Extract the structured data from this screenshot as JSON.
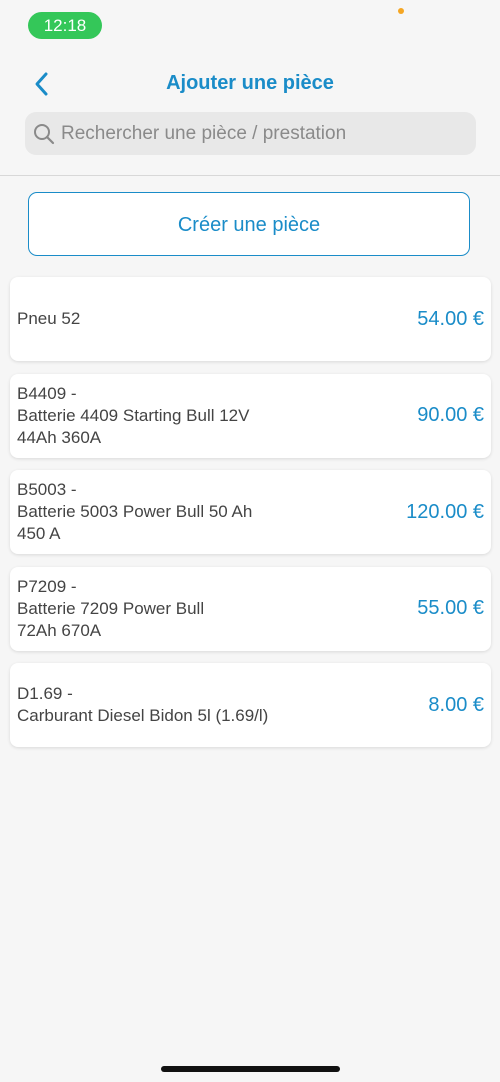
{
  "status_bar": {
    "time": "12:18"
  },
  "header": {
    "title": "Ajouter une pièce",
    "back_icon": "chevron-left-icon"
  },
  "search": {
    "placeholder": "Rechercher une pièce / prestation",
    "value": "",
    "icon": "search-icon"
  },
  "create_button": {
    "label": "Créer une pièce"
  },
  "parts": [
    {
      "name": "Pneu 52",
      "price": "54.00 €"
    },
    {
      "name": "B4409 -\nBatterie 4409 Starting Bull 12V\n44Ah 360A",
      "price": "90.00 €"
    },
    {
      "name": "B5003 -\nBatterie 5003 Power Bull 50 Ah\n450 A",
      "price": "120.00 €"
    },
    {
      "name": "P7209  -\nBatterie 7209 Power Bull\n72Ah 670A",
      "price": "55.00 €"
    },
    {
      "name": "D1.69 -\nCarburant Diesel Bidon 5l (1.69/l)",
      "price": "8.00 €"
    }
  ],
  "colors": {
    "accent": "#1a8cc8",
    "time_pill": "#34c759",
    "background": "#f6f6f6"
  }
}
